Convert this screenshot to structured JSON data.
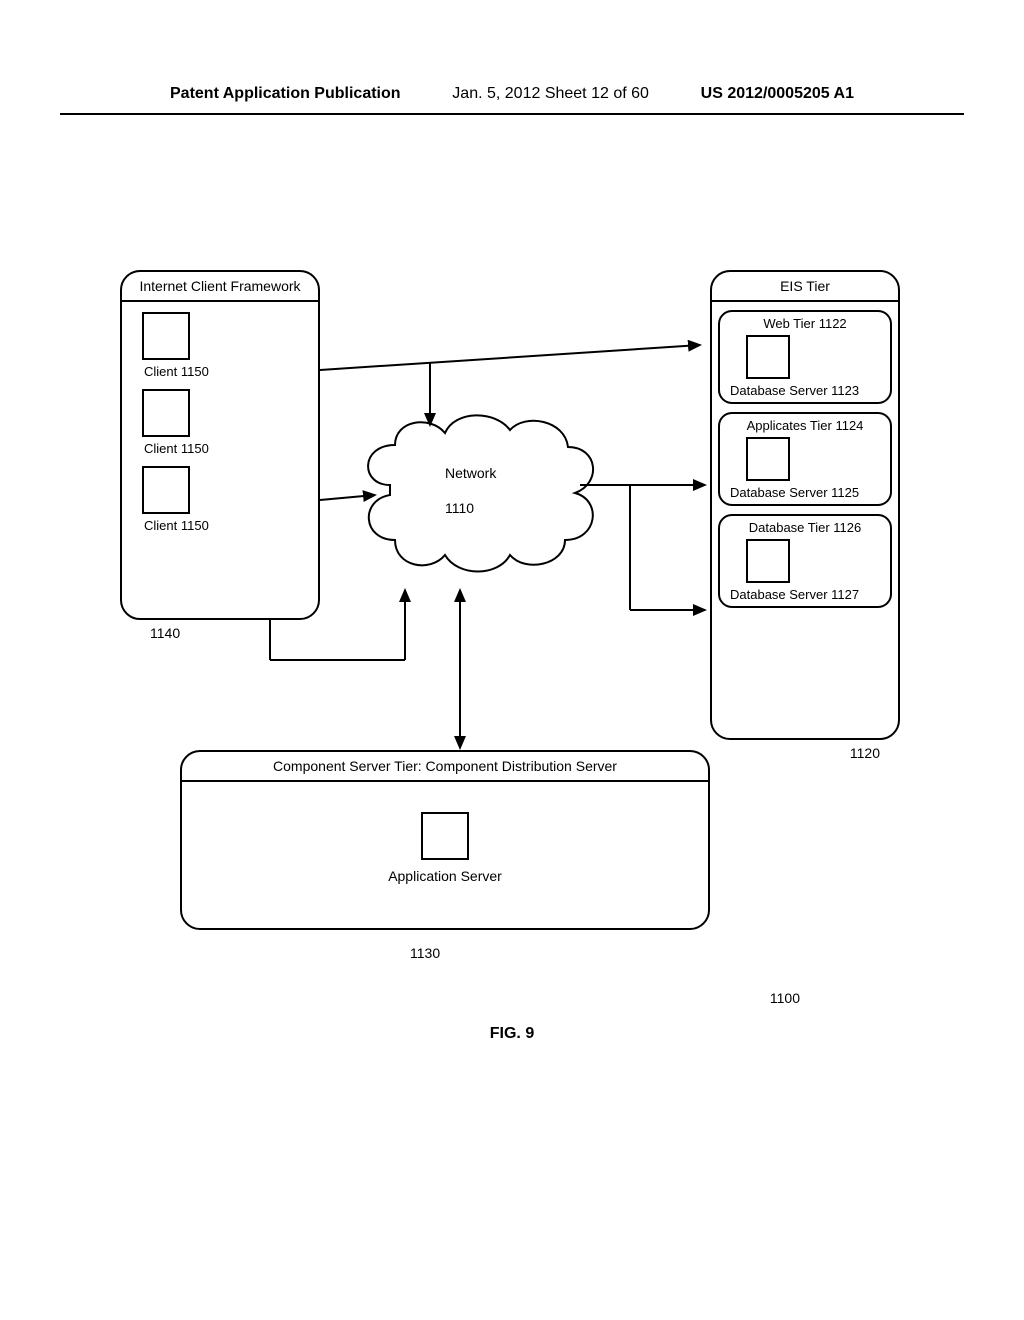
{
  "header": {
    "left": "Patent Application Publication",
    "center": "Jan. 5, 2012   Sheet 12 of 60",
    "right": "US 2012/0005205 A1"
  },
  "client_framework": {
    "title": "Internet Client Framework",
    "clients": [
      {
        "label": "Client 1150"
      },
      {
        "label": "Client 1150"
      },
      {
        "label": "Client 1150"
      }
    ],
    "ref": "1140"
  },
  "eis_tier": {
    "title": "EIS Tier",
    "sub_tiers": [
      {
        "title": "Web Tier 1122",
        "label": "Database Server 1123"
      },
      {
        "title": "Applicates Tier 1124",
        "label": "Database Server 1125"
      },
      {
        "title": "Database Tier 1126",
        "label": "Database Server 1127"
      }
    ],
    "ref": "1120"
  },
  "component_tier": {
    "title": "Component Server Tier: Component Distribution Server",
    "label": "Application Server",
    "ref": "1130"
  },
  "network": {
    "title": "Network",
    "ref": "1110"
  },
  "overall_ref": "1100",
  "figure_label": "FIG. 9"
}
